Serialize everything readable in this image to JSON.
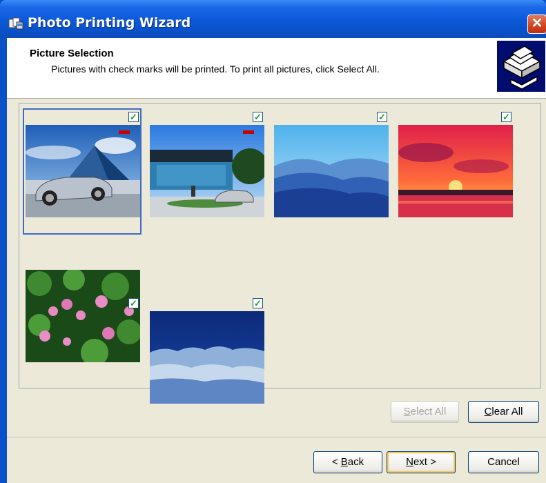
{
  "window": {
    "title": "Photo Printing Wizard",
    "close_glyph": "✕"
  },
  "header": {
    "title": "Picture Selection",
    "description": "Pictures with check marks will be printed.  To print all pictures, click Select All.",
    "icon": "printer-photos-icon"
  },
  "pictures": [
    {
      "subject": "silver car in front of pyramid building",
      "checked": true,
      "selected": true
    },
    {
      "subject": "car in front of modern glass building",
      "checked": true,
      "selected": false
    },
    {
      "subject": "blue mountain ridges",
      "checked": true,
      "selected": false
    },
    {
      "subject": "red sunset over water",
      "checked": true,
      "selected": false
    },
    {
      "subject": "pink water lilies",
      "checked": true,
      "selected": false
    },
    {
      "subject": "frosted blue forest",
      "checked": true,
      "selected": false
    }
  ],
  "buttons": {
    "select_all": {
      "label_prefix": "",
      "accel": "S",
      "label_rest": "elect All",
      "enabled": false
    },
    "clear_all": {
      "label_prefix": "",
      "accel": "C",
      "label_rest": "lear All",
      "enabled": true
    },
    "back": {
      "label_prefix": "< ",
      "accel": "B",
      "label_rest": "ack",
      "enabled": true
    },
    "next": {
      "label_prefix": "",
      "accel": "N",
      "label_rest": "ext >",
      "enabled": true
    },
    "cancel": {
      "label": "Cancel",
      "enabled": true
    }
  },
  "colors": {
    "titlebar": "#0a50c8",
    "dialog_background": "#ece9d8",
    "selection": "#3d6bc4",
    "check": "#21a121"
  }
}
